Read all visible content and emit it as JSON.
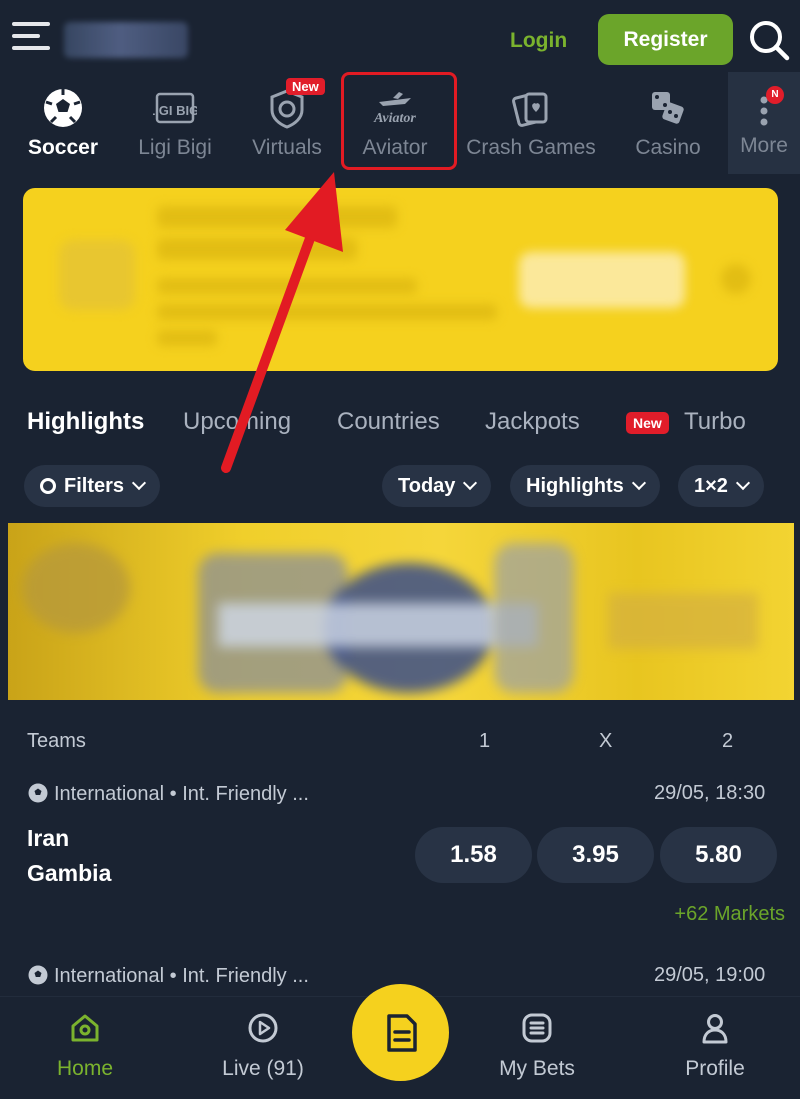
{
  "header": {
    "login_label": "Login",
    "register_label": "Register"
  },
  "categories": [
    {
      "label": "Soccer",
      "icon": "soccer-ball-icon",
      "active": true
    },
    {
      "label": "Ligi Bigi",
      "icon": "ligi-bigi-logo-icon",
      "icon_text": "LIGI BIGI"
    },
    {
      "label": "Virtuals",
      "icon": "virtuals-shield-icon",
      "badge": "New"
    },
    {
      "label": "Aviator",
      "icon": "aviator-plane-icon",
      "icon_text": "Aviator"
    },
    {
      "label": "Crash Games",
      "icon": "cards-icon"
    },
    {
      "label": "Casino",
      "icon": "dice-icon"
    },
    {
      "label": "More",
      "icon": "more-dots-icon",
      "badge": "N"
    }
  ],
  "tabs": {
    "items": [
      "Highlights",
      "Upcoming",
      "Countries",
      "Jackpots",
      "Turbo"
    ],
    "active": "Highlights",
    "turbo_badge": "New"
  },
  "filters": {
    "filters_label": "Filters",
    "today_label": "Today",
    "highlights_label": "Highlights",
    "market_label": "1×2"
  },
  "table": {
    "headers": {
      "teams": "Teams",
      "one": "1",
      "x": "X",
      "two": "2"
    },
    "matches": [
      {
        "league": "International • Int. Friendly ...",
        "datetime": "29/05, 18:30",
        "home": "Iran",
        "away": "Gambia",
        "odds": [
          "1.58",
          "3.95",
          "5.80"
        ],
        "markets": "+62 Markets"
      },
      {
        "league": "International • Int. Friendly ...",
        "datetime": "29/05, 19:00"
      }
    ]
  },
  "bottom_nav": {
    "home": "Home",
    "live": "Live (91)",
    "my_bets": "My Bets",
    "profile": "Profile"
  },
  "colors": {
    "background": "#1a2332",
    "accent_green": "#6ba52a",
    "brand_yellow": "#f5d11e",
    "badge_red": "#e11d2a",
    "annotation_red": "#e21b23"
  }
}
